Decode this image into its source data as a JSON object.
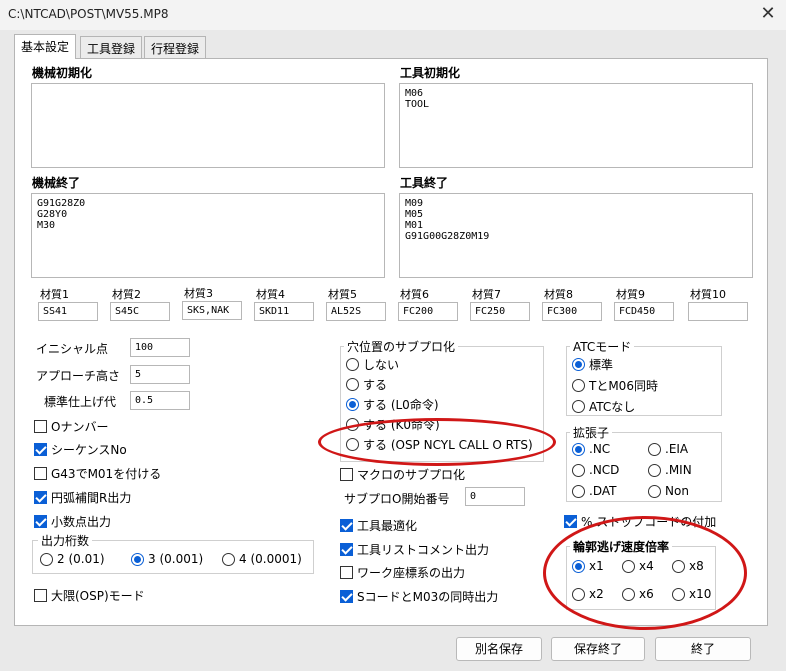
{
  "window": {
    "title": "C:\\NTCAD\\POST\\MV55.MP8"
  },
  "tabs": [
    {
      "label": "基本設定"
    },
    {
      "label": "工具登録"
    },
    {
      "label": "行程登録"
    }
  ],
  "machine_init": {
    "label": "機械初期化",
    "value": ""
  },
  "tool_init": {
    "label": "工具初期化",
    "value": "M06\nTOOL"
  },
  "machine_end": {
    "label": "機械終了",
    "value": "G91G28Z0\nG28Y0\nM30"
  },
  "tool_end": {
    "label": "工具終了",
    "value": "M09\nM05\nM01\nG91G00G28Z0M19"
  },
  "materials": [
    {
      "label": "材質1",
      "value": "SS41"
    },
    {
      "label": "材質2",
      "value": "S45C"
    },
    {
      "label": "材質3",
      "value": "SKS,NAK"
    },
    {
      "label": "材質4",
      "value": "SKD11"
    },
    {
      "label": "材質5",
      "value": "AL52S"
    },
    {
      "label": "材質6",
      "value": "FC200"
    },
    {
      "label": "材質7",
      "value": "FC250"
    },
    {
      "label": "材質8",
      "value": "FC300"
    },
    {
      "label": "材質9",
      "value": "FCD450"
    },
    {
      "label": "材質10",
      "value": ""
    }
  ],
  "params": {
    "initial_point": {
      "label": "イニシャル点",
      "value": "100"
    },
    "approach_height": {
      "label": "アプローチ高さ",
      "value": "5"
    },
    "finish_allowance": {
      "label": "標準仕上げ代",
      "value": "0.5"
    }
  },
  "checks_left": [
    {
      "label": "Oナンバー",
      "checked": false
    },
    {
      "label": "シーケンスNo",
      "checked": true
    },
    {
      "label": "G43でM01を付ける",
      "checked": false
    },
    {
      "label": "円弧補間R出力",
      "checked": true
    },
    {
      "label": "小数点出力",
      "checked": true
    }
  ],
  "decimal_digits": {
    "label": "出力桁数",
    "options": [
      {
        "label": "2 (0.01)",
        "selected": false
      },
      {
        "label": "3 (0.001)",
        "selected": true
      },
      {
        "label": "4 (0.0001)",
        "selected": false
      }
    ]
  },
  "osp_mode": {
    "label": "大隈(OSP)モード",
    "checked": false
  },
  "hole_subprog": {
    "label": "穴位置のサブプロ化",
    "options": [
      {
        "label": "しない",
        "selected": false
      },
      {
        "label": "する",
        "selected": false
      },
      {
        "label": "する (L0命令)",
        "selected": true
      },
      {
        "label": "する (K0命令)",
        "selected": false
      },
      {
        "label": "する (OSP NCYL CALL O RTS)",
        "selected": false
      }
    ]
  },
  "macro_subprog": {
    "label": "マクロのサブプロ化",
    "checked": false
  },
  "subprog_start": {
    "label": "サブプロO開始番号",
    "value": "0"
  },
  "checks_mid": [
    {
      "label": "工具最適化",
      "checked": true
    },
    {
      "label": "工具リストコメント出力",
      "checked": true
    },
    {
      "label": "ワーク座標系の出力",
      "checked": false
    },
    {
      "label": "SコードとM03の同時出力",
      "checked": true
    }
  ],
  "atc_mode": {
    "label": "ATCモード",
    "options": [
      {
        "label": "標準",
        "selected": true
      },
      {
        "label": "TとM06同時",
        "selected": false
      },
      {
        "label": "ATCなし",
        "selected": false
      }
    ]
  },
  "extension": {
    "label": "拡張子",
    "options": [
      {
        "label": ".NC",
        "selected": true
      },
      {
        "label": ".EIA",
        "selected": false
      },
      {
        "label": ".NCD",
        "selected": false
      },
      {
        "label": ".MIN",
        "selected": false
      },
      {
        "label": ".DAT",
        "selected": false
      },
      {
        "label": "Non",
        "selected": false
      }
    ]
  },
  "percent_stop": {
    "label": "% ストップコードの付加",
    "checked": true
  },
  "contour_speed": {
    "label": "輪郭逃げ速度倍率",
    "options": [
      {
        "label": "x1",
        "selected": true
      },
      {
        "label": "x4",
        "selected": false
      },
      {
        "label": "x8",
        "selected": false
      },
      {
        "label": "x2",
        "selected": false
      },
      {
        "label": "x6",
        "selected": false
      },
      {
        "label": "x10",
        "selected": false
      }
    ]
  },
  "buttons": {
    "save_as": "別名保存",
    "save_exit": "保存終了",
    "exit": "終了"
  },
  "annotation_color": "#d01717",
  "accent_color": "#0a5fd6"
}
